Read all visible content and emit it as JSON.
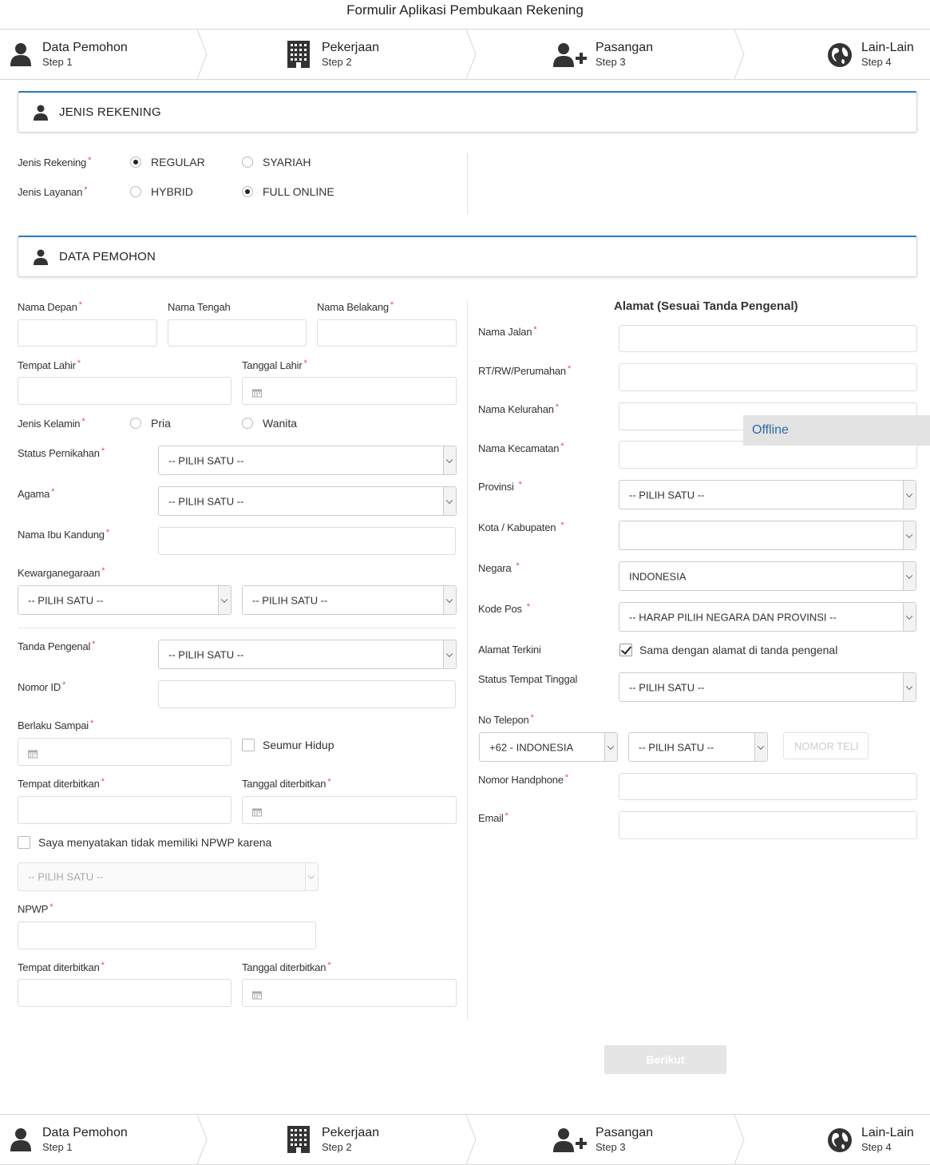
{
  "page_title": "Formulir Aplikasi Pembukaan Rekening",
  "steps": [
    {
      "name": "Data Pemohon",
      "step": "Step 1"
    },
    {
      "name": "Pekerjaan",
      "step": "Step 2"
    },
    {
      "name": "Pasangan",
      "step": "Step 3"
    },
    {
      "name": "Lain-Lain",
      "step": "Step 4"
    }
  ],
  "jenis_rekening_section": {
    "title": "JENIS REKENING",
    "jenis_rekening_label": "Jenis Rekening",
    "jenis_rekening_options": [
      "REGULAR",
      "SYARIAH"
    ],
    "jenis_rekening_selected": "REGULAR",
    "jenis_layanan_label": "Jenis Layanan",
    "jenis_layanan_options": [
      "HYBRID",
      "FULL ONLINE"
    ],
    "jenis_layanan_selected": "FULL ONLINE"
  },
  "data_pemohon_section": {
    "title": "DATA PEMOHON",
    "nama_depan": "Nama Depan",
    "nama_tengah": "Nama Tengah",
    "nama_belakang": "Nama Belakang",
    "tempat_lahir": "Tempat Lahir",
    "tanggal_lahir": "Tanggal Lahir",
    "jenis_kelamin": "Jenis Kelamin",
    "gender_options": [
      "Pria",
      "Wanita"
    ],
    "status_pernikahan": "Status Pernikahan",
    "agama": "Agama",
    "nama_ibu": "Nama Ibu Kandung",
    "kewarganegaraan": "Kewarganegaraan",
    "tanda_pengenal": "Tanda Pengenal",
    "nomor_id": "Nomor ID",
    "berlaku_sampai": "Berlaku Sampai",
    "seumur_hidup": "Seumur Hidup",
    "tempat_diterbitkan": "Tempat diterbitkan",
    "tanggal_diterbitkan": "Tanggal diterbitkan",
    "npwp_statement": "Saya menyatakan tidak memiliki NPWP karena",
    "npwp": "NPWP",
    "pilih_satu": "-- PILIH SATU --"
  },
  "alamat_section": {
    "title": "Alamat (Sesuai Tanda Pengenal)",
    "nama_jalan": "Nama Jalan",
    "rt_rw": "RT/RW/Perumahan",
    "kelurahan": "Nama Kelurahan",
    "kecamatan": "Nama Kecamatan",
    "provinsi": "Provinsi",
    "provinsi_value": "-- PILIH SATU --",
    "kota": "Kota / Kabupaten",
    "negara": "Negara",
    "negara_value": "INDONESIA",
    "kode_pos": "Kode Pos",
    "kode_pos_value": "-- HARAP PILIH NEGARA DAN PROVINSI --",
    "alamat_terkini": "Alamat Terkini",
    "alamat_terkini_check": "Sama dengan alamat di tanda pengenal",
    "status_tinggal": "Status Tempat Tinggal",
    "status_tinggal_value": "-- PILIH SATU --",
    "no_telepon": "No Telepon",
    "country_code_value": "+62 - INDONESIA",
    "phone_type_value": "-- PILIH SATU --",
    "phone_placeholder": "NOMOR TELI",
    "nomor_handphone": "Nomor Handphone",
    "email": "Email"
  },
  "offline_badge": "Offline",
  "next_button": "Berikut",
  "colors": {
    "accent": "#2a7ab8",
    "required": "#d9534f"
  }
}
